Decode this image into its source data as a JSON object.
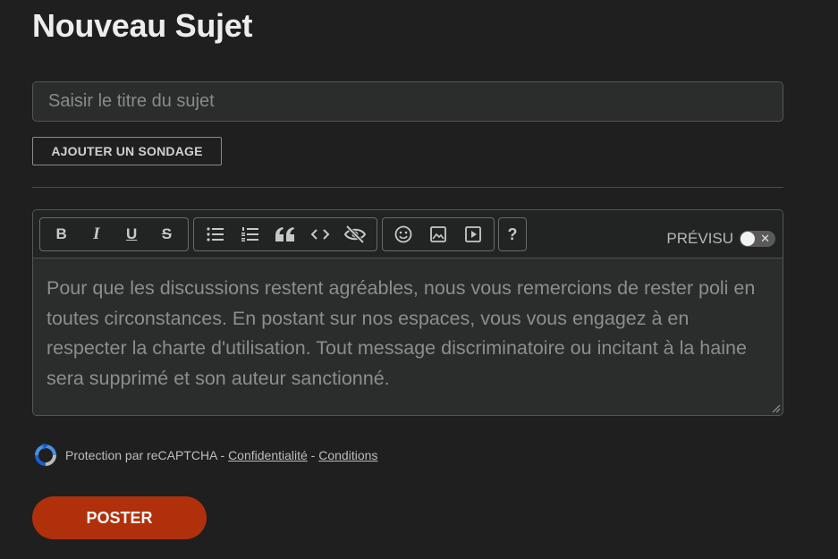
{
  "page": {
    "title": "Nouveau Sujet"
  },
  "form": {
    "title_placeholder": "Saisir le titre du sujet",
    "title_value": "",
    "poll_button_label": "AJOUTER UN SONDAGE"
  },
  "editor": {
    "toolbar": {
      "groups": [
        [
          "bold-icon",
          "italic-icon",
          "underline-icon",
          "strikethrough-icon"
        ],
        [
          "bullet-list-icon",
          "numbered-list-icon",
          "quote-icon",
          "code-icon",
          "spoiler-eye-icon"
        ],
        [
          "emoji-icon",
          "image-icon",
          "video-icon"
        ],
        [
          "help-icon"
        ]
      ],
      "bold_glyph": "B",
      "italic_glyph": "I",
      "underline_glyph": "U",
      "strike_glyph": "S",
      "help_glyph": "?"
    },
    "preview_label": "PRÉVISU",
    "preview_enabled": false,
    "toggle_off_glyph": "✕",
    "body_placeholder": "Pour que les discussions restent agréables, nous vous remercions de rester poli en toutes circonstances. En postant sur nos espaces, vous vous engagez à en respecter la charte d'utilisation. Tout message discriminatoire ou incitant à la haine sera supprimé et son auteur sanctionné.",
    "body_value": ""
  },
  "recaptcha": {
    "prefix": "Protection par reCAPTCHA - ",
    "privacy_label": "Confidentialité",
    "separator": " - ",
    "terms_label": "Conditions"
  },
  "actions": {
    "post_label": "POSTER"
  },
  "colors": {
    "background": "#1f1f1f",
    "accent": "#b0300c",
    "input_bg": "#2b2c2c"
  }
}
